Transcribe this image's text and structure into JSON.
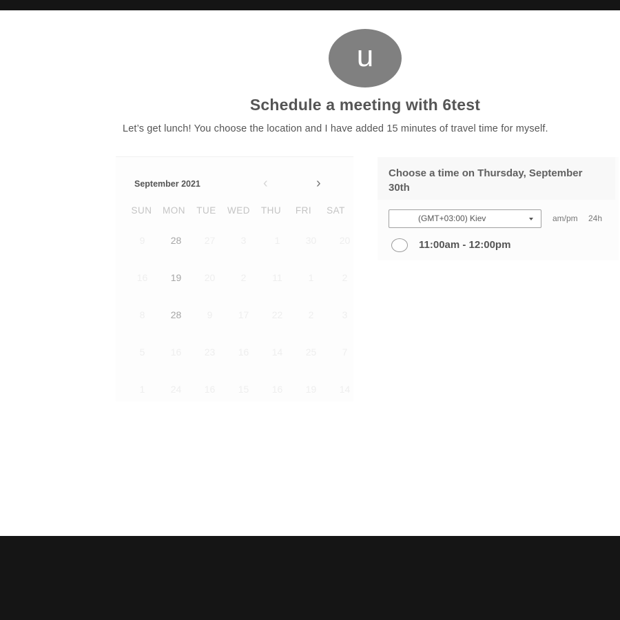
{
  "header": {
    "avatar_initial": "u",
    "title": "Schedule a meeting with 6test",
    "subtitle": "Let’s get lunch! You choose the location and I have added 15 minutes of travel time for myself."
  },
  "calendar": {
    "month_label": "September 2021",
    "prev_label": "‹",
    "next_label": "›",
    "weekdays": [
      "SUN",
      "MON",
      "TUE",
      "WED",
      "THU",
      "FRI",
      "SAT"
    ],
    "weeks": [
      [
        "9",
        "28",
        "27",
        "3",
        "1",
        "30",
        "20"
      ],
      [
        "16",
        "19",
        "20",
        "2",
        "11",
        "1",
        "2"
      ],
      [
        "8",
        "28",
        "9",
        "17",
        "22",
        "2",
        "3"
      ],
      [
        "5",
        "16",
        "23",
        "16",
        "14",
        "25",
        "7"
      ],
      [
        "1",
        "24",
        "16",
        "15",
        "16",
        "19",
        "14"
      ]
    ]
  },
  "schedule": {
    "heading": "Choose a time on Thursday, September 30th",
    "timezone": "(GMT+03:00) Kiev",
    "format_ampm": "am/pm",
    "format_24h": "24h",
    "slots": [
      "11:00am - 12:00pm"
    ]
  }
}
